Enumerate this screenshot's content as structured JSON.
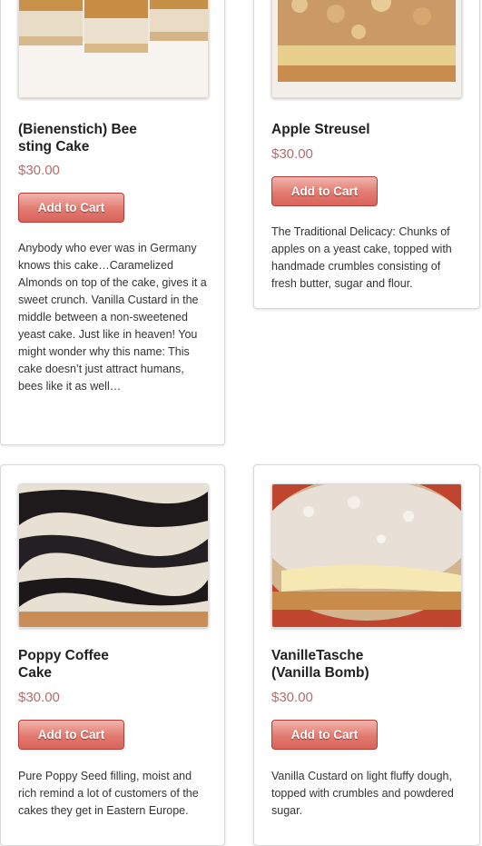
{
  "products": [
    {
      "title_line1": "(Bienenstich) Bee",
      "title_line2": "sting Cake",
      "price": "$30.00",
      "button_label": "Add to Cart",
      "description": "Anybody who ever was in Germany knows this cake…Caramelized Almonds on top of the cake, gives it a sweet crunch. Vanilla Custard in the middle between a  non-sweetened yeast cake. Just like in heaven! You might wonder why this   name: This cake doesn’t just attract humans, bees like it as well…"
    },
    {
      "title_line1": "Apple Streusel",
      "title_line2": "",
      "price": "$30.00",
      "button_label": "Add to Cart",
      "description": "The Traditional Delicacy: Chunks of apples on a yeast cake, topped with handmade crumbles consisting of fresh butter, sugar and flour."
    },
    {
      "title_line1": "Poppy Coffee",
      "title_line2": "Cake",
      "price": "$30.00",
      "button_label": "Add to Cart",
      "description": "Pure Poppy Seed filling, moist and rich remind a lot of customers of the cakes they get in Eastern Europe."
    },
    {
      "title_line1": "VanilleTasche",
      "title_line2": "(Vanilla Bomb)",
      "price": "$30.00",
      "button_label": "Add to Cart",
      "description": "Vanilla Custard on light fluffy dough, topped with crumbles and powdered sugar."
    }
  ]
}
